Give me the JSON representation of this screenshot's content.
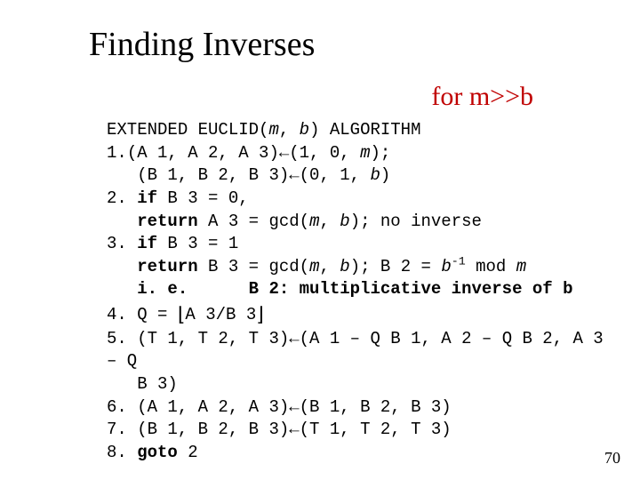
{
  "title": "Finding Inverses",
  "subtitle": "for m>>b",
  "page_number": "70",
  "algo": {
    "header_pre": "EXTENDED EUCLID(",
    "header_args_m": "m",
    "header_sep": ", ",
    "header_args_b": "b",
    "header_post": ") ALGORITHM",
    "s1_num": "1.",
    "s1a_pre": "(A 1, A 2, A 3)",
    "arrow": "←",
    "s1a_post_pre": "(1, 0, ",
    "s1a_m": "m",
    "s1a_post_suf": ");",
    "s1b_pre": "   (B 1, B 2, B 3)",
    "s1b_post_pre": "(0, 1, ",
    "s1b_b": "b",
    "s1b_post_suf": ")",
    "s2_num": "2.",
    "s2if_pre": " ",
    "s2if": "if",
    "s2if_post": " B 3 = 0,",
    "s2ret_indent": "   ",
    "s2ret": "return",
    "s2ret_post_pre": " A 3 = gcd(",
    "s2ret_m": "m",
    "s2ret_sep": ", ",
    "s2ret_b": "b",
    "s2ret_post_suf": "); no inverse",
    "s3_num": "3.",
    "s3if_pre": " ",
    "s3if": "if",
    "s3if_post": " B 3 = 1",
    "s3ret_indent": "   ",
    "s3ret": "return",
    "s3ret_post_pre": " B 3 = gcd(",
    "s3ret_m": "m",
    "s3ret_sep": ", ",
    "s3ret_b": "b",
    "s3ret_post_suf1": "); B 2 = ",
    "s3ret_bital": "b",
    "s3ret_sup": "-1",
    "s3ret_post_suf2": " mod ",
    "s3ret_mital": "m",
    "s3ie_indent": "   ",
    "s3ie": "i. e.      B 2: multiplicative inverse of b",
    "s4_num": "4.",
    "s4body_pre": " Q = ",
    "floorL": "⌊",
    "s4body_mid": "A 3/B 3",
    "floorR": "⌋",
    "s5_num": "5.",
    "s5a_pre": " (T 1, T 2, T 3)",
    "s5a_post": "(A 1 – Q B 1, A 2 – Q B 2, A 3 – Q",
    "s5b": "   B 3)",
    "s6_num": "6.",
    "s6_pre": " (A 1, A 2, A 3)",
    "s6_post": "(B 1, B 2, B 3)",
    "s7_num": "7.",
    "s7_pre": " (B 1, B 2, B 3)",
    "s7_post": "(T 1, T 2, T 3)",
    "s8_num": "8.",
    "s8body_pre": " ",
    "s8body": "goto",
    "s8body_post": " 2"
  }
}
